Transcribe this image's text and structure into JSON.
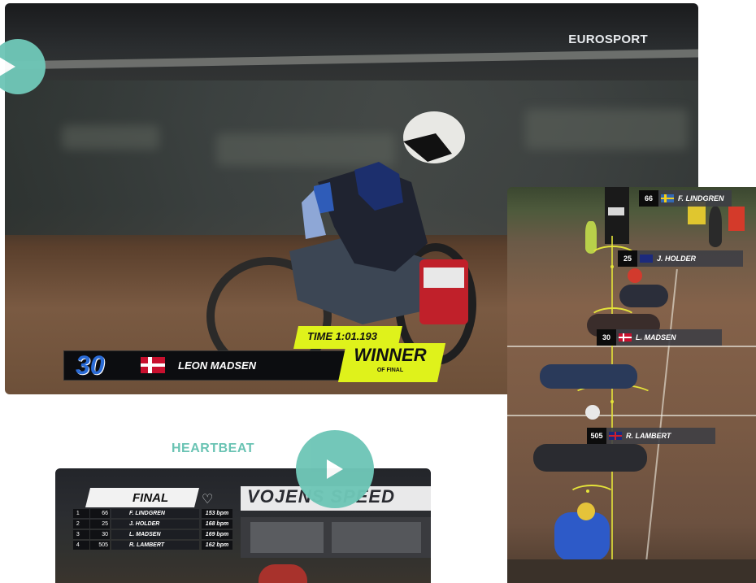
{
  "main_video": {
    "channel_logo": "EUROSPORT",
    "rider_number": "30",
    "rider_name": "LEON MADSEN",
    "time_label": "TIME 1:01.193",
    "result_title": "WINNER",
    "result_subtitle": "OF FINAL",
    "play_icon": "play-icon"
  },
  "bottom_video": {
    "label": "HEARTBEAT",
    "final_title": "FINAL",
    "heart_icon": "heart-rate-icon",
    "banner": "VOJENS SPEED",
    "leaderboard": [
      {
        "pos": "1",
        "num": "66",
        "name": "F. LINDGREN",
        "speed": "153 bpm",
        "color": "#e2452b"
      },
      {
        "pos": "2",
        "num": "25",
        "name": "J. HOLDER",
        "speed": "168 bpm",
        "color": "#3a74d9"
      },
      {
        "pos": "3",
        "num": "30",
        "name": "L. MADSEN",
        "speed": "169 bpm",
        "color": "#f2f2f2"
      },
      {
        "pos": "4",
        "num": "505",
        "name": "R. LAMBERT",
        "speed": "162 bpm",
        "color": "#e6d93a"
      }
    ]
  },
  "right_video": {
    "tags": [
      {
        "num": "66",
        "flag": "sweden-flag-icon",
        "name": "F. LINDGREN"
      },
      {
        "num": "25",
        "flag": "australia-flag-icon",
        "name": "J. HOLDER"
      },
      {
        "num": "30",
        "flag": "denmark-flag-icon",
        "name": "L. MADSEN"
      },
      {
        "num": "505",
        "flag": "uk-flag-icon",
        "name": "R. LAMBERT"
      }
    ]
  },
  "colors": {
    "accent_teal": "#6fc6b7",
    "highlight_yellow": "#dff21b"
  }
}
